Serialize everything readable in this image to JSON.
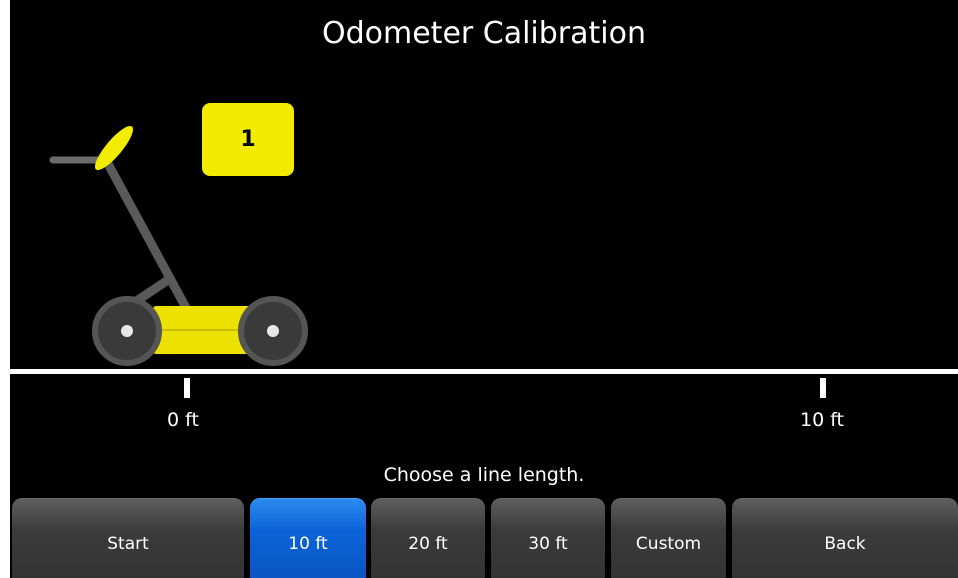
{
  "title": "Odometer Calibration",
  "step_number": "1",
  "scale": {
    "start_label": "0 ft",
    "end_label": "10 ft"
  },
  "instruction": "Choose a line length.",
  "buttons": [
    {
      "label": "Start",
      "active": false
    },
    {
      "label": "10 ft",
      "active": true
    },
    {
      "label": "20 ft",
      "active": false
    },
    {
      "label": "30 ft",
      "active": false
    },
    {
      "label": "Custom",
      "active": false
    },
    {
      "label": "Back",
      "active": false
    }
  ],
  "colors": {
    "background": "#000000",
    "accent_yellow": "#f2ec00",
    "selected_blue": "#0c63d8",
    "button_gray": "#3b3b3b"
  },
  "icons": {
    "cart": "gpr-cart-icon"
  }
}
